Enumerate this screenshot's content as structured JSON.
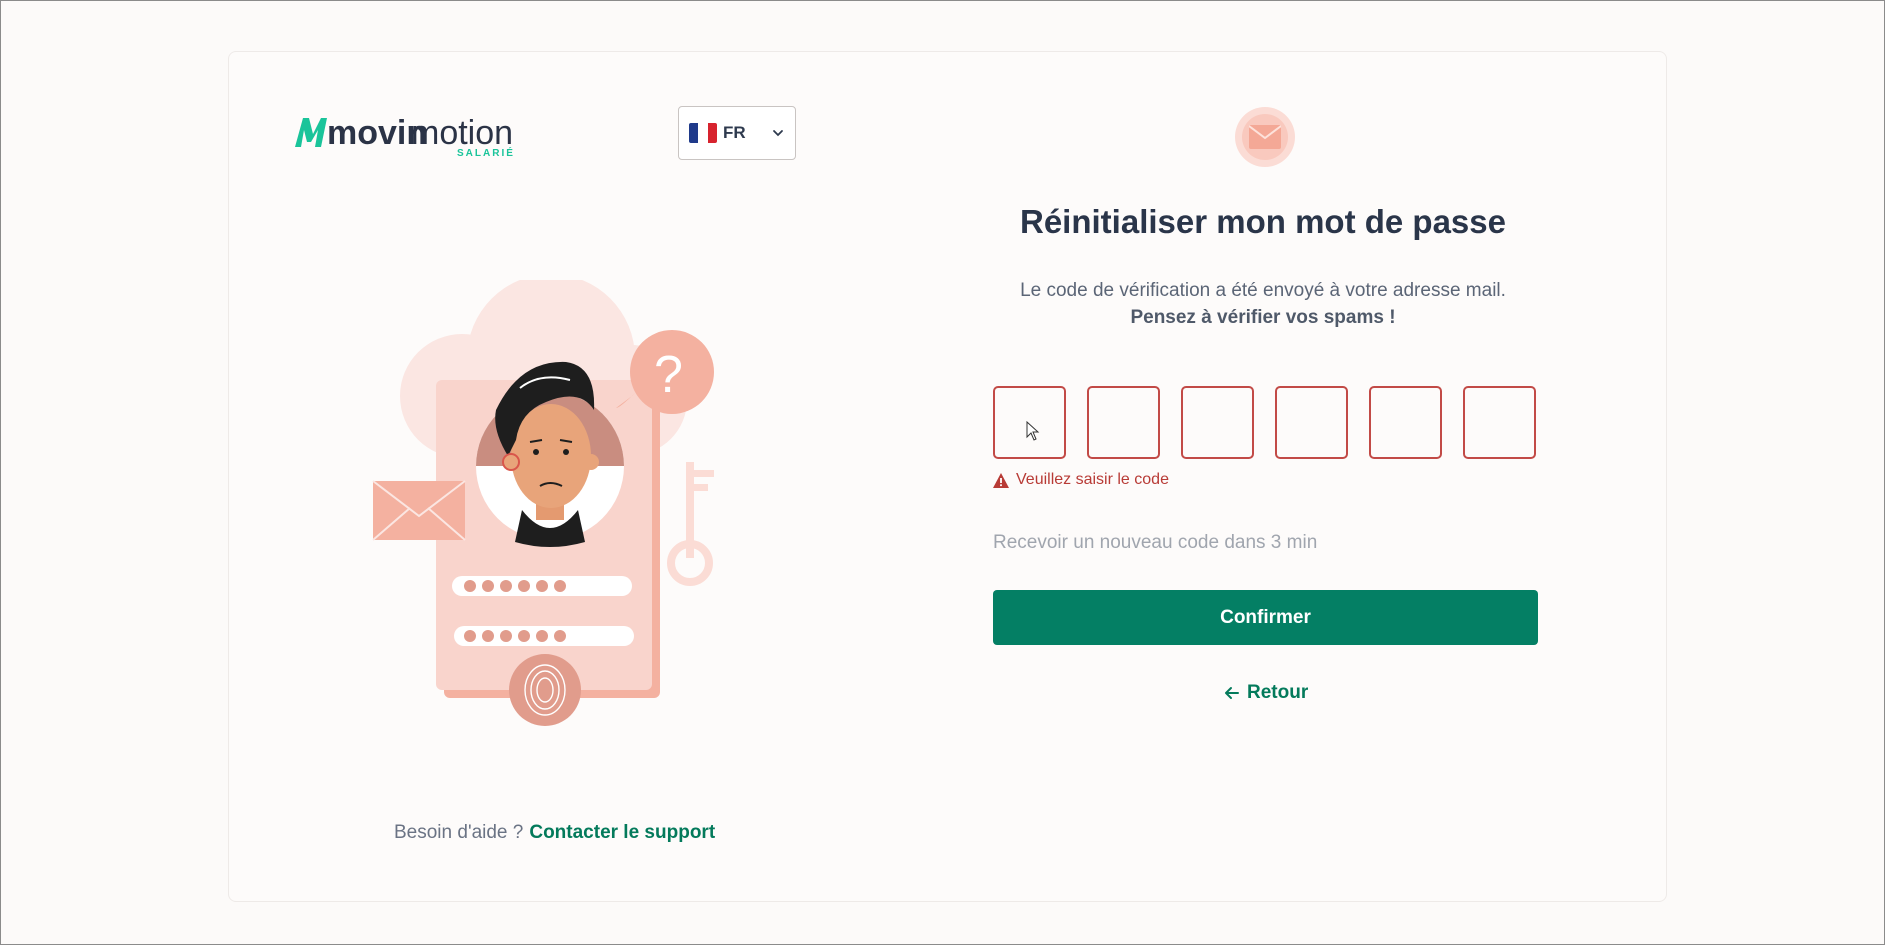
{
  "brand": {
    "name_part1": "movin",
    "name_part2": "motion",
    "tagline": "SALARIÉ"
  },
  "language": {
    "code": "FR",
    "flag": "french-flag-icon"
  },
  "colors": {
    "accent": "#047f64",
    "error": "#c24a46",
    "title": "#2a3549",
    "illustration": "#f4b1a0"
  },
  "header": {
    "icon": "envelope-icon"
  },
  "main": {
    "title": "Réinitialiser mon mot de passe",
    "subtitle": "Le code de vérification a été envoyé à votre adresse mail.",
    "subtitle_bold": "Pensez à vérifier vos spams !",
    "code_inputs": [
      "",
      "",
      "",
      "",
      "",
      ""
    ],
    "error_message": "Veuillez saisir le code",
    "resend_text": "Recevoir un nouveau code dans 3 min",
    "confirm_label": "Confirmer",
    "back_label": "Retour"
  },
  "footer": {
    "help_text": "Besoin d'aide ?",
    "support_link": "Contacter le support"
  }
}
